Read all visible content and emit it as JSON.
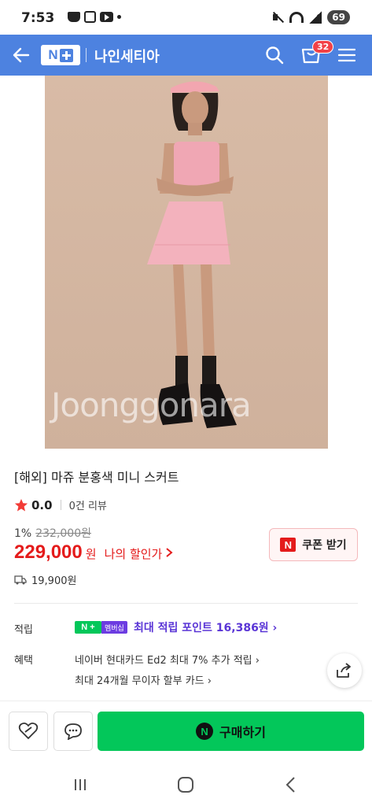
{
  "status": {
    "time": "7:53",
    "battery": "69"
  },
  "header": {
    "store_name": "나인세티아",
    "cart_count": "32"
  },
  "product": {
    "title": "[해외] 마쥬 분홍색 미니 스커트",
    "watermark": "Joonggonara",
    "rating": "0.0",
    "reviews": "0건 리뷰",
    "discount_percent": "1%",
    "original_price": "232,000원",
    "price": "229,000",
    "price_unit": "원",
    "my_price_label": "나의 할인가",
    "coupon_label": "쿠폰 받기",
    "shipping": "19,900원"
  },
  "points": {
    "label": "적립",
    "member_tag": "멤버십",
    "text": "최대 적립 포인트 16,386원 ›"
  },
  "benefits": {
    "label": "혜택",
    "line1": "네이버 현대카드 Ed2 최대 7% 추가 적립 ›",
    "line2": "최대 24개월 무이자 할부 카드 ›"
  },
  "bottom": {
    "buy_label": "구매하기"
  },
  "colors": {
    "header": "#4d82e0",
    "price": "#e41b1b",
    "buy": "#03c75a",
    "points": "#5a35d6"
  }
}
